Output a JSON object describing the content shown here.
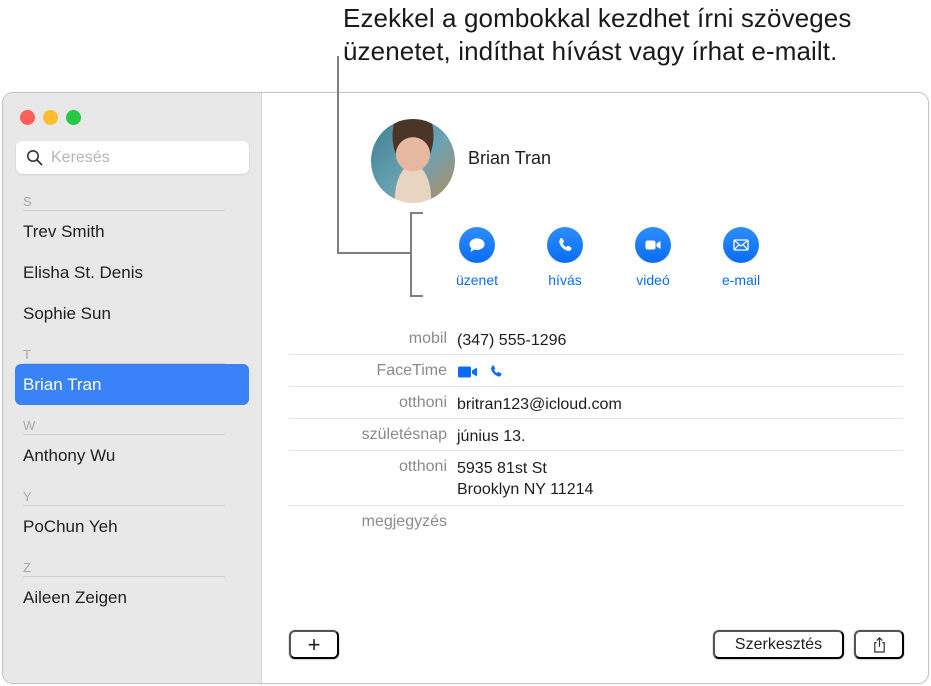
{
  "callout": {
    "text_line1": "Ezekkel a gombokkal kezdhet írni szöveges",
    "text_line2": "üzenetet, indíthat hívást vagy írhat e-mailt."
  },
  "window": {
    "traffic_lights": [
      "close",
      "minimize",
      "maximize"
    ]
  },
  "sidebar": {
    "search": {
      "placeholder": "Keresés",
      "value": "",
      "icon": "search-icon"
    },
    "sections": [
      {
        "letter": "S",
        "contacts": [
          "Trev Smith",
          "Elisha St. Denis",
          "Sophie Sun"
        ]
      },
      {
        "letter": "T",
        "contacts": [
          "Brian Tran"
        ]
      },
      {
        "letter": "W",
        "contacts": [
          "Anthony Wu"
        ]
      },
      {
        "letter": "Y",
        "contacts": [
          "PoChun Yeh"
        ]
      },
      {
        "letter": "Z",
        "contacts": [
          "Aileen Zeigen"
        ]
      }
    ],
    "selected": "Brian Tran"
  },
  "detail": {
    "name": "Brian Tran",
    "actions": [
      {
        "label": "üzenet",
        "icon": "message-bubble-icon"
      },
      {
        "label": "hívás",
        "icon": "phone-icon"
      },
      {
        "label": "videó",
        "icon": "video-camera-icon"
      },
      {
        "label": "e-mail",
        "icon": "envelope-icon"
      }
    ],
    "fields": [
      {
        "label": "mobil",
        "value": "(347) 555-1296"
      },
      {
        "label": "FaceTime",
        "icons": [
          "video-camera-icon",
          "phone-icon"
        ]
      },
      {
        "label": "otthoni",
        "value": "britran123@icloud.com"
      },
      {
        "label": "születésnap",
        "value": "június 13."
      },
      {
        "label": "otthoni",
        "value_line1": "5935 81st St",
        "value_line2": "Brooklyn NY 11214"
      },
      {
        "label": "megjegyzés",
        "value": ""
      }
    ]
  },
  "footer": {
    "add_label": "+",
    "edit_label": "Szerkesztés",
    "share_icon": "share-icon"
  },
  "colors": {
    "accent": "#0a6cf5",
    "selection": "#3a82f7",
    "sidebar_bg": "#e8e8e8"
  }
}
